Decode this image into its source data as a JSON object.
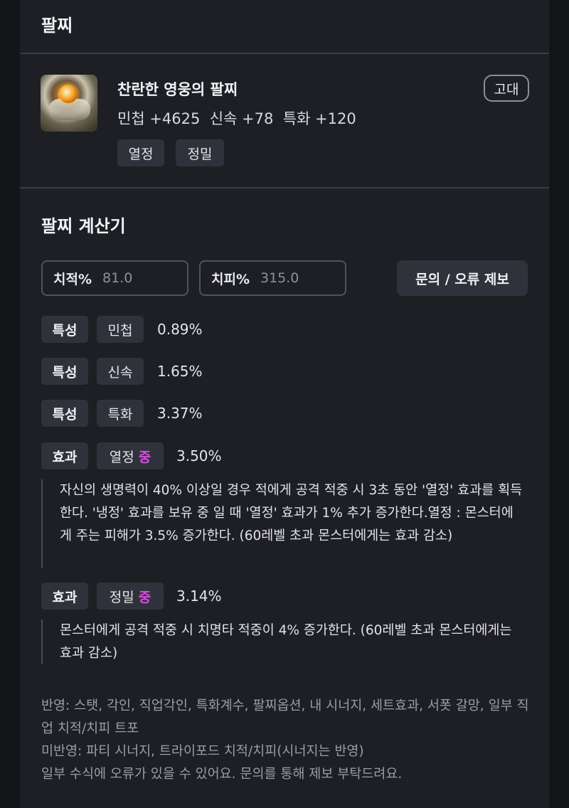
{
  "header": {
    "title": "팔찌"
  },
  "item": {
    "name": "찬란한 영웅의 팔찌",
    "stats": "민첩 +4625  신속 +78  특화 +120",
    "grade": "고대",
    "icon": "bracelet-icon",
    "tags": [
      "열정",
      "정밀"
    ]
  },
  "calculator": {
    "title": "팔찌 계산기",
    "crit_rate": {
      "label": "치적%",
      "value": "81.0"
    },
    "crit_damage": {
      "label": "치피%",
      "value": "315.0"
    },
    "report_button": "문의 / 오류 제보",
    "traits": [
      {
        "kind": "특성",
        "stat": "민첩",
        "percent": "0.89%"
      },
      {
        "kind": "특성",
        "stat": "신속",
        "percent": "1.65%"
      },
      {
        "kind": "특성",
        "stat": "특화",
        "percent": "3.37%"
      }
    ],
    "effects": [
      {
        "kind": "효과",
        "name": "열정",
        "grade": "중",
        "percent": "3.50%",
        "description": "자신의 생명력이 40% 이상일 경우 적에게 공격 적중 시 3초 동안 '열정' 효과를 획득한다. '냉정' 효과를 보유 중 일 때 '열정' 효과가 1% 추가 증가한다.열정 : 몬스터에게 주는 피해가 3.5% 증가한다. (60레벨 초과 몬스터에게는 효과 감소)"
      },
      {
        "kind": "효과",
        "name": "정밀",
        "grade": "중",
        "percent": "3.14%",
        "description": "몬스터에게 공격 적중 시 치명타 적중이 4% 증가한다. (60레벨 초과 몬스터에게는 효과 감소)"
      }
    ]
  },
  "footer": {
    "reflected": "반영: 스탯, 각인, 직업각인, 특화계수, 팔찌옵션, 내 시너지, 세트효과, 서폿 갈망, 일부 직업 치적/치피 트포",
    "not_reflected": "미반영: 파티 시너지, 트라이포드 치적/치피(시너지는 반영)",
    "notice": "일부 수식에 오류가 있을 수 있어요. 문의를 통해 제보 부탁드려요."
  },
  "colors": {
    "background": "#141519",
    "panel": "#1e1f25",
    "chip": "#30323b",
    "grade_mid": "#d84ce0"
  }
}
